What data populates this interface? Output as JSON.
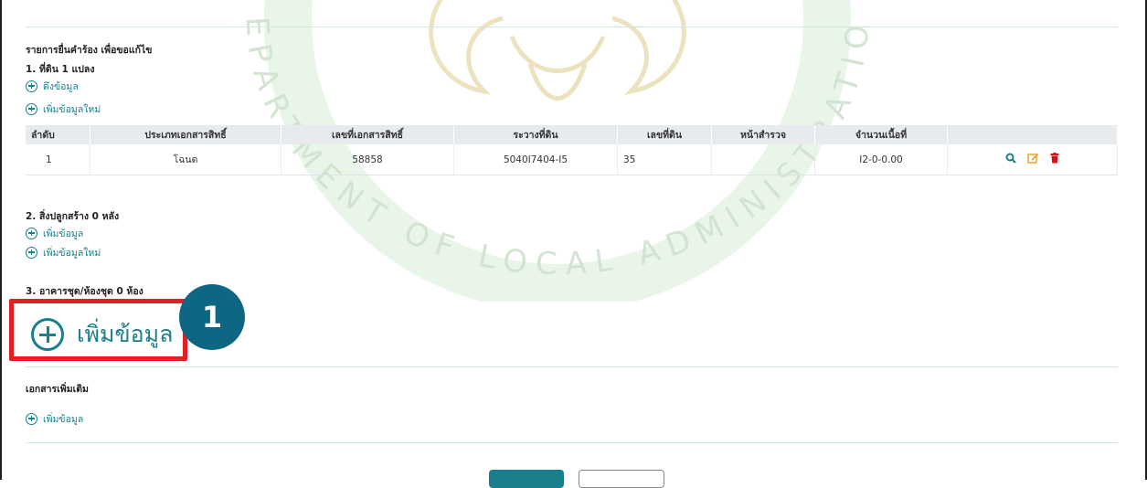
{
  "watermark": {
    "text": "DEPARTMENT OF LOCAL ADMINISTRATION"
  },
  "section_header": {
    "title": "รายการยื่นคำร้อง เพื่อขอแก้ไข"
  },
  "land": {
    "title": "1. ที่ดิน 1 แปลง",
    "fetch_label": "ดึงข้อมูล",
    "add_new_label": "เพิ่มข้อมูลใหม่",
    "columns": [
      "ลำดับ",
      "ประเภทเอกสารสิทธิ์",
      "เลขที่เอกสารสิทธิ์",
      "ระวางที่ดิน",
      "เลขที่ดิน",
      "หน้าสำรวจ",
      "จำนวนเนื้อที่",
      ""
    ],
    "rows": [
      {
        "no": "1",
        "doc_type": "โฉนด",
        "doc_no": "58858",
        "map_sheet": "5040I7404-I5",
        "parcel_no": "35",
        "survey_page": "",
        "area": "I2-0-0.00"
      }
    ],
    "action_icons": [
      "search-icon",
      "edit-icon",
      "delete-icon"
    ]
  },
  "buildings": {
    "title": "2. สิ่งปลูกสร้าง 0 หลัง",
    "add_label": "เพิ่มข้อมูล",
    "add_new_label": "เพิ่มข้อมูลใหม่"
  },
  "condo": {
    "title": "3. อาคารชุด/ห้องชุด 0 ห้อง",
    "add_label": "เพิ่มข้อมูล"
  },
  "callout": {
    "number": "1"
  },
  "extra_docs": {
    "title": "เอกสารเพิ่มเติม",
    "add_label": "เพิ่มข้อมูล"
  },
  "colors": {
    "accent": "#1a7f8c",
    "highlight": "#e31e24",
    "badge": "#0f6683",
    "delete": "#d9101a",
    "edit": "#e9a230"
  }
}
